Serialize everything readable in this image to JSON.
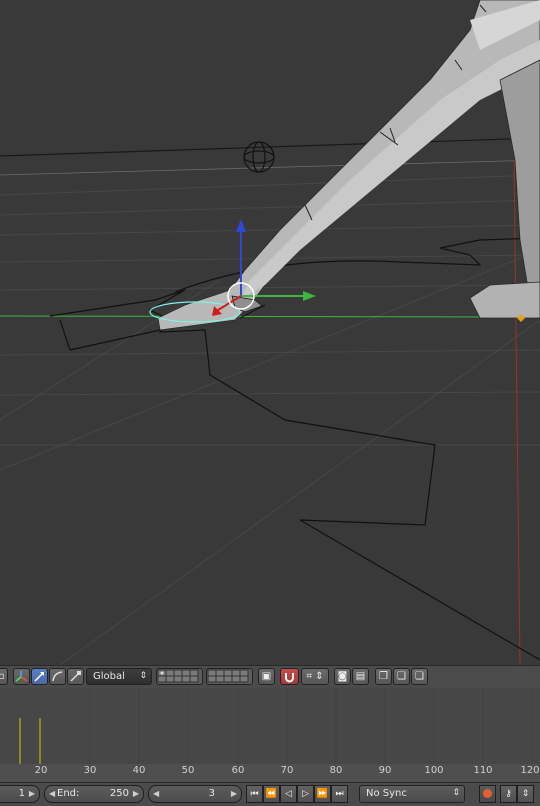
{
  "header": {
    "orientation_label": "Global",
    "orientation_arrow": "⇕"
  },
  "timeline": {
    "ruler_labels": [
      "20",
      "30",
      "40",
      "50",
      "60",
      "70",
      "80",
      "90",
      "100",
      "110",
      "120"
    ]
  },
  "footer": {
    "start_value": "1",
    "end_label": "End:",
    "end_value": "250",
    "current_frame": "3",
    "sync_label": "No Sync",
    "sync_arrow": "⇕"
  },
  "colors": {
    "viewport_bg": "#393939",
    "x_axis": "#9b3030",
    "y_axis": "#3fb43f",
    "z_axis": "#2f46d8",
    "keyframe": "#d8c800",
    "active_button": "#5a7fc2",
    "magnet_button": "#c84b4b"
  },
  "icons": {
    "manipulator": "manipulator-icon",
    "translate": "translate-icon",
    "rotate": "rotate-icon",
    "scale": "scale-icon",
    "pivot": "pivot-icon",
    "layers": "layers-grid-icon",
    "snap": "magnet-icon",
    "render": "render-icon",
    "copy": "copy-icon",
    "paste": "paste-icon",
    "keying": "keying-icon",
    "record": "record-icon"
  }
}
